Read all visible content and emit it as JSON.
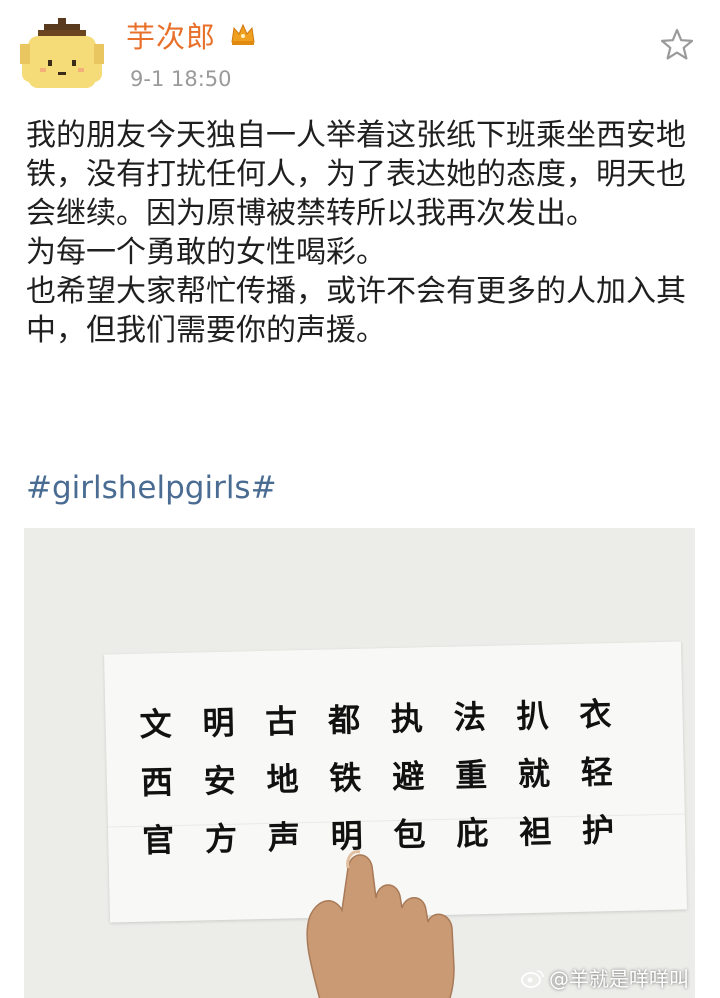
{
  "post": {
    "author": "芋次郎",
    "timestamp": "9-1 18:50",
    "paragraphs": [
      "我的朋友今天独自一人举着这张纸下班乘坐西安地铁，没有打扰任何人，为了表达她的态度，明天也会继续。因为原博被禁转所以我再次发出。",
      "为每一个勇敢的女性喝彩。",
      "也希望大家帮忙传播，或许不会有更多的人加入其中，但我们需要你的声援。"
    ],
    "hashtag": "#girlshelpgirls#"
  },
  "photo": {
    "sign_rows": [
      [
        "文",
        "明",
        "古",
        "都",
        "执",
        "法",
        "扒",
        "衣"
      ],
      [
        "西",
        "安",
        "地",
        "铁",
        "避",
        "重",
        "就",
        "轻"
      ],
      [
        "官",
        "方",
        "声",
        "明",
        "包",
        "庇",
        "袒",
        "护"
      ]
    ]
  },
  "watermark": {
    "text": "@羊就是咩咩叫"
  },
  "icons": {
    "avatar": "pompompurin-avatar-icon",
    "vip": "crown-badge-icon",
    "favorite": "star-icon",
    "watermark_logo": "weibo-icon"
  },
  "colors": {
    "username": "#e8702a",
    "hashtag": "#4a6c92",
    "timestamp": "#9a9a9a"
  }
}
